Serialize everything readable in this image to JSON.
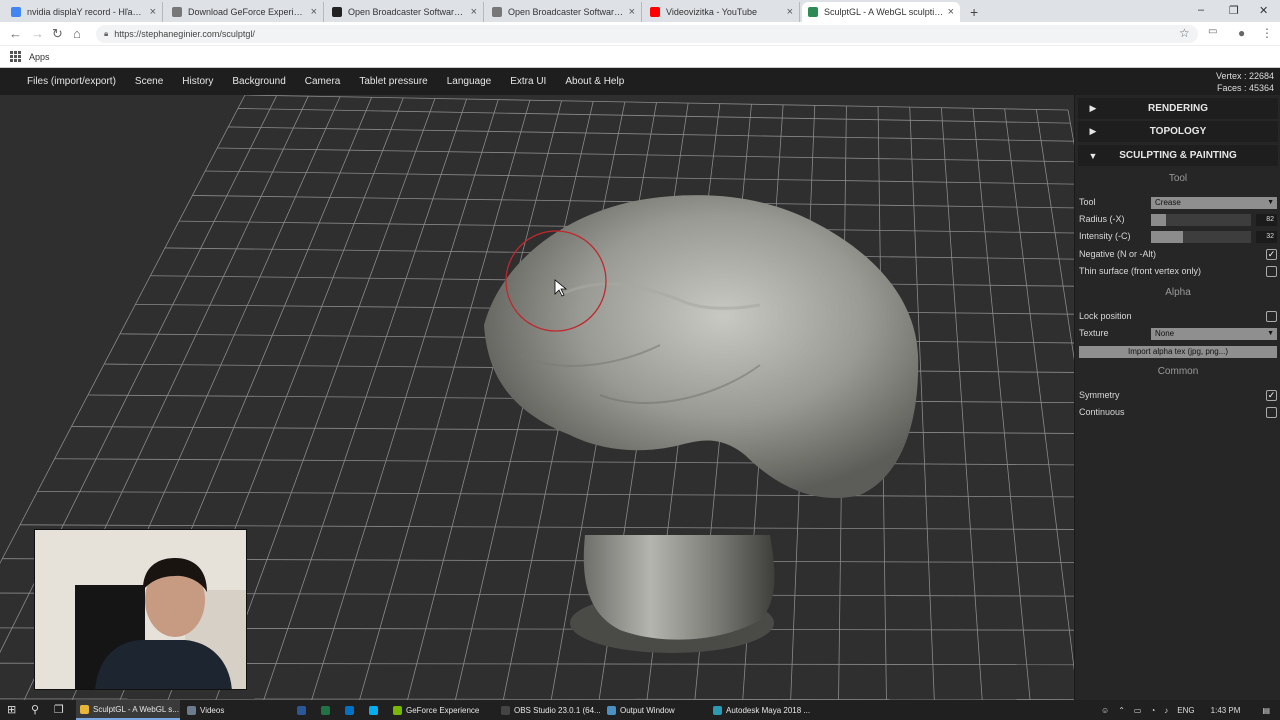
{
  "browser": {
    "tabs": [
      {
        "title": "nvidia displaY record - Hľadať G",
        "icon": "google-icon",
        "color": "#4285f4"
      },
      {
        "title": "Download GeForce Experience | N",
        "icon": "page-icon",
        "color": "#777777"
      },
      {
        "title": "Open Broadcaster Software | Hom",
        "icon": "obs-icon",
        "color": "#222222"
      },
      {
        "title": "Open Broadcaster Software | We",
        "icon": "page-icon",
        "color": "#777777"
      },
      {
        "title": "Videovizitka - YouTube",
        "icon": "youtube-icon",
        "color": "#ff0000"
      },
      {
        "title": "SculptGL - A WebGL sculpting ap",
        "icon": "sculptgl-icon",
        "color": "#2e8b57",
        "active": true
      }
    ],
    "new_tab": "+",
    "window_controls": [
      "–",
      "❐",
      "✕"
    ],
    "url": "https://stephaneginier.com/sculptgl/",
    "bookmark_apps": "Apps"
  },
  "menubar": {
    "items": [
      "Files (import/export)",
      "Scene",
      "History",
      "Background",
      "Camera",
      "Tablet pressure",
      "Language",
      "Extra UI",
      "About & Help"
    ]
  },
  "stats": {
    "vertex": "Vertex : 22684",
    "faces": "Faces : 45364"
  },
  "panel": {
    "sections": [
      {
        "title": "RENDERING",
        "arrow": "▶"
      },
      {
        "title": "TOPOLOGY",
        "arrow": "▶"
      },
      {
        "title": "SCULPTING & PAINTING",
        "arrow": "▼"
      }
    ],
    "tool_header": "Tool",
    "tool_label": "Tool",
    "tool_value": "Crease",
    "radius_label": "Radius (-X)",
    "radius_value": "82",
    "radius_fraction": 0.15,
    "intensity_label": "Intensity (-C)",
    "intensity_value": "32",
    "intensity_fraction": 0.32,
    "negative_label": "Negative (N or -Alt)",
    "negative_checked": true,
    "thin_label": "Thin surface (front vertex only)",
    "thin_checked": false,
    "alpha_header": "Alpha",
    "lock_label": "Lock position",
    "lock_checked": false,
    "texture_label": "Texture",
    "texture_value": "None",
    "import_button": "Import alpha tex (jpg, png...)",
    "common_header": "Common",
    "symmetry_label": "Symmetry",
    "symmetry_checked": true,
    "continuous_label": "Continuous",
    "continuous_checked": false
  },
  "taskbar": {
    "apps": [
      {
        "label": "SculptGL - A WebGL s...",
        "icon": "chrome-icon",
        "color": "#e8b73a",
        "active": true
      },
      {
        "label": "Videos",
        "icon": "folder-icon",
        "color": "#6d7c8c"
      },
      {
        "label": "",
        "icon": "word-icon",
        "color": "#2b579a"
      },
      {
        "label": "",
        "icon": "excel-icon",
        "color": "#217346"
      },
      {
        "label": "",
        "icon": "outlook-icon",
        "color": "#0072c6"
      },
      {
        "label": "",
        "icon": "skype-icon",
        "color": "#00aff0"
      },
      {
        "label": "GeForce Experience",
        "icon": "geforce-icon",
        "color": "#76b900"
      },
      {
        "label": "OBS Studio 23.0.1 (64...",
        "icon": "obs-icon",
        "color": "#444444"
      },
      {
        "label": "Output Window",
        "icon": "window-icon",
        "color": "#4a90c2"
      },
      {
        "label": "Autodesk Maya 2018 ...",
        "icon": "maya-icon",
        "color": "#2a9bb5"
      }
    ],
    "language": "ENG",
    "clock": "1:43 PM"
  }
}
